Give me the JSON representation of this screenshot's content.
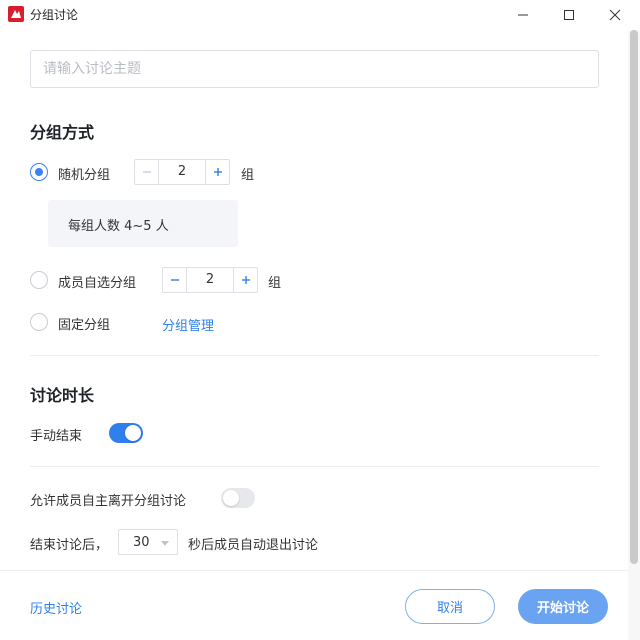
{
  "window": {
    "title": "分组讨论",
    "icons": {
      "app": "app-logo-icon",
      "minimize": "minimize-icon",
      "maximize": "maximize-icon",
      "close": "close-icon"
    }
  },
  "topic": {
    "placeholder": "请输入讨论主题",
    "value": ""
  },
  "grouping": {
    "title": "分组方式",
    "options": [
      {
        "label": "随机分组",
        "checked": true,
        "count": "2",
        "unit": "组"
      },
      {
        "label": "成员自选分组",
        "checked": false,
        "count": "2",
        "unit": "组"
      },
      {
        "label": "固定分组",
        "checked": false,
        "link": "分组管理"
      }
    ],
    "random_info": "每组人数 4~5 人"
  },
  "duration": {
    "title": "讨论时长",
    "manual_end_label": "手动结束",
    "manual_end_on": true
  },
  "settings": {
    "allow_leave_label": "允许成员自主离开分组讨论",
    "allow_leave_on": false,
    "end_prefix": "结束讨论后，",
    "end_seconds": "30",
    "end_suffix": "秒后成员自动退出讨论"
  },
  "footer": {
    "history": "历史讨论",
    "cancel": "取消",
    "start": "开始讨论"
  },
  "colors": {
    "accent": "#2f80ed",
    "start_button": "#6aa3f2",
    "brand": "#d81e2c"
  }
}
